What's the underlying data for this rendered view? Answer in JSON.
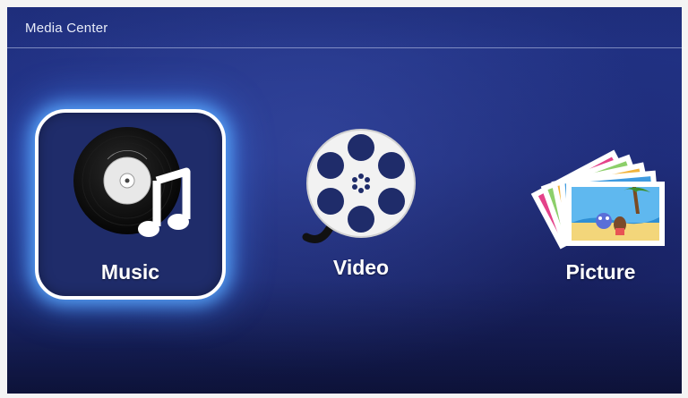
{
  "app": {
    "title": "Media Center"
  },
  "menu": {
    "items": [
      {
        "id": "music",
        "label": "Music",
        "icon": "vinyl-music-note-icon",
        "selected": true
      },
      {
        "id": "video",
        "label": "Video",
        "icon": "film-reel-icon",
        "selected": false
      },
      {
        "id": "picture",
        "label": "Picture",
        "icon": "photo-stack-icon",
        "selected": false
      }
    ]
  },
  "colors": {
    "background": "#23348a",
    "selection_glow": "#5aaaff",
    "text": "#ffffff"
  }
}
